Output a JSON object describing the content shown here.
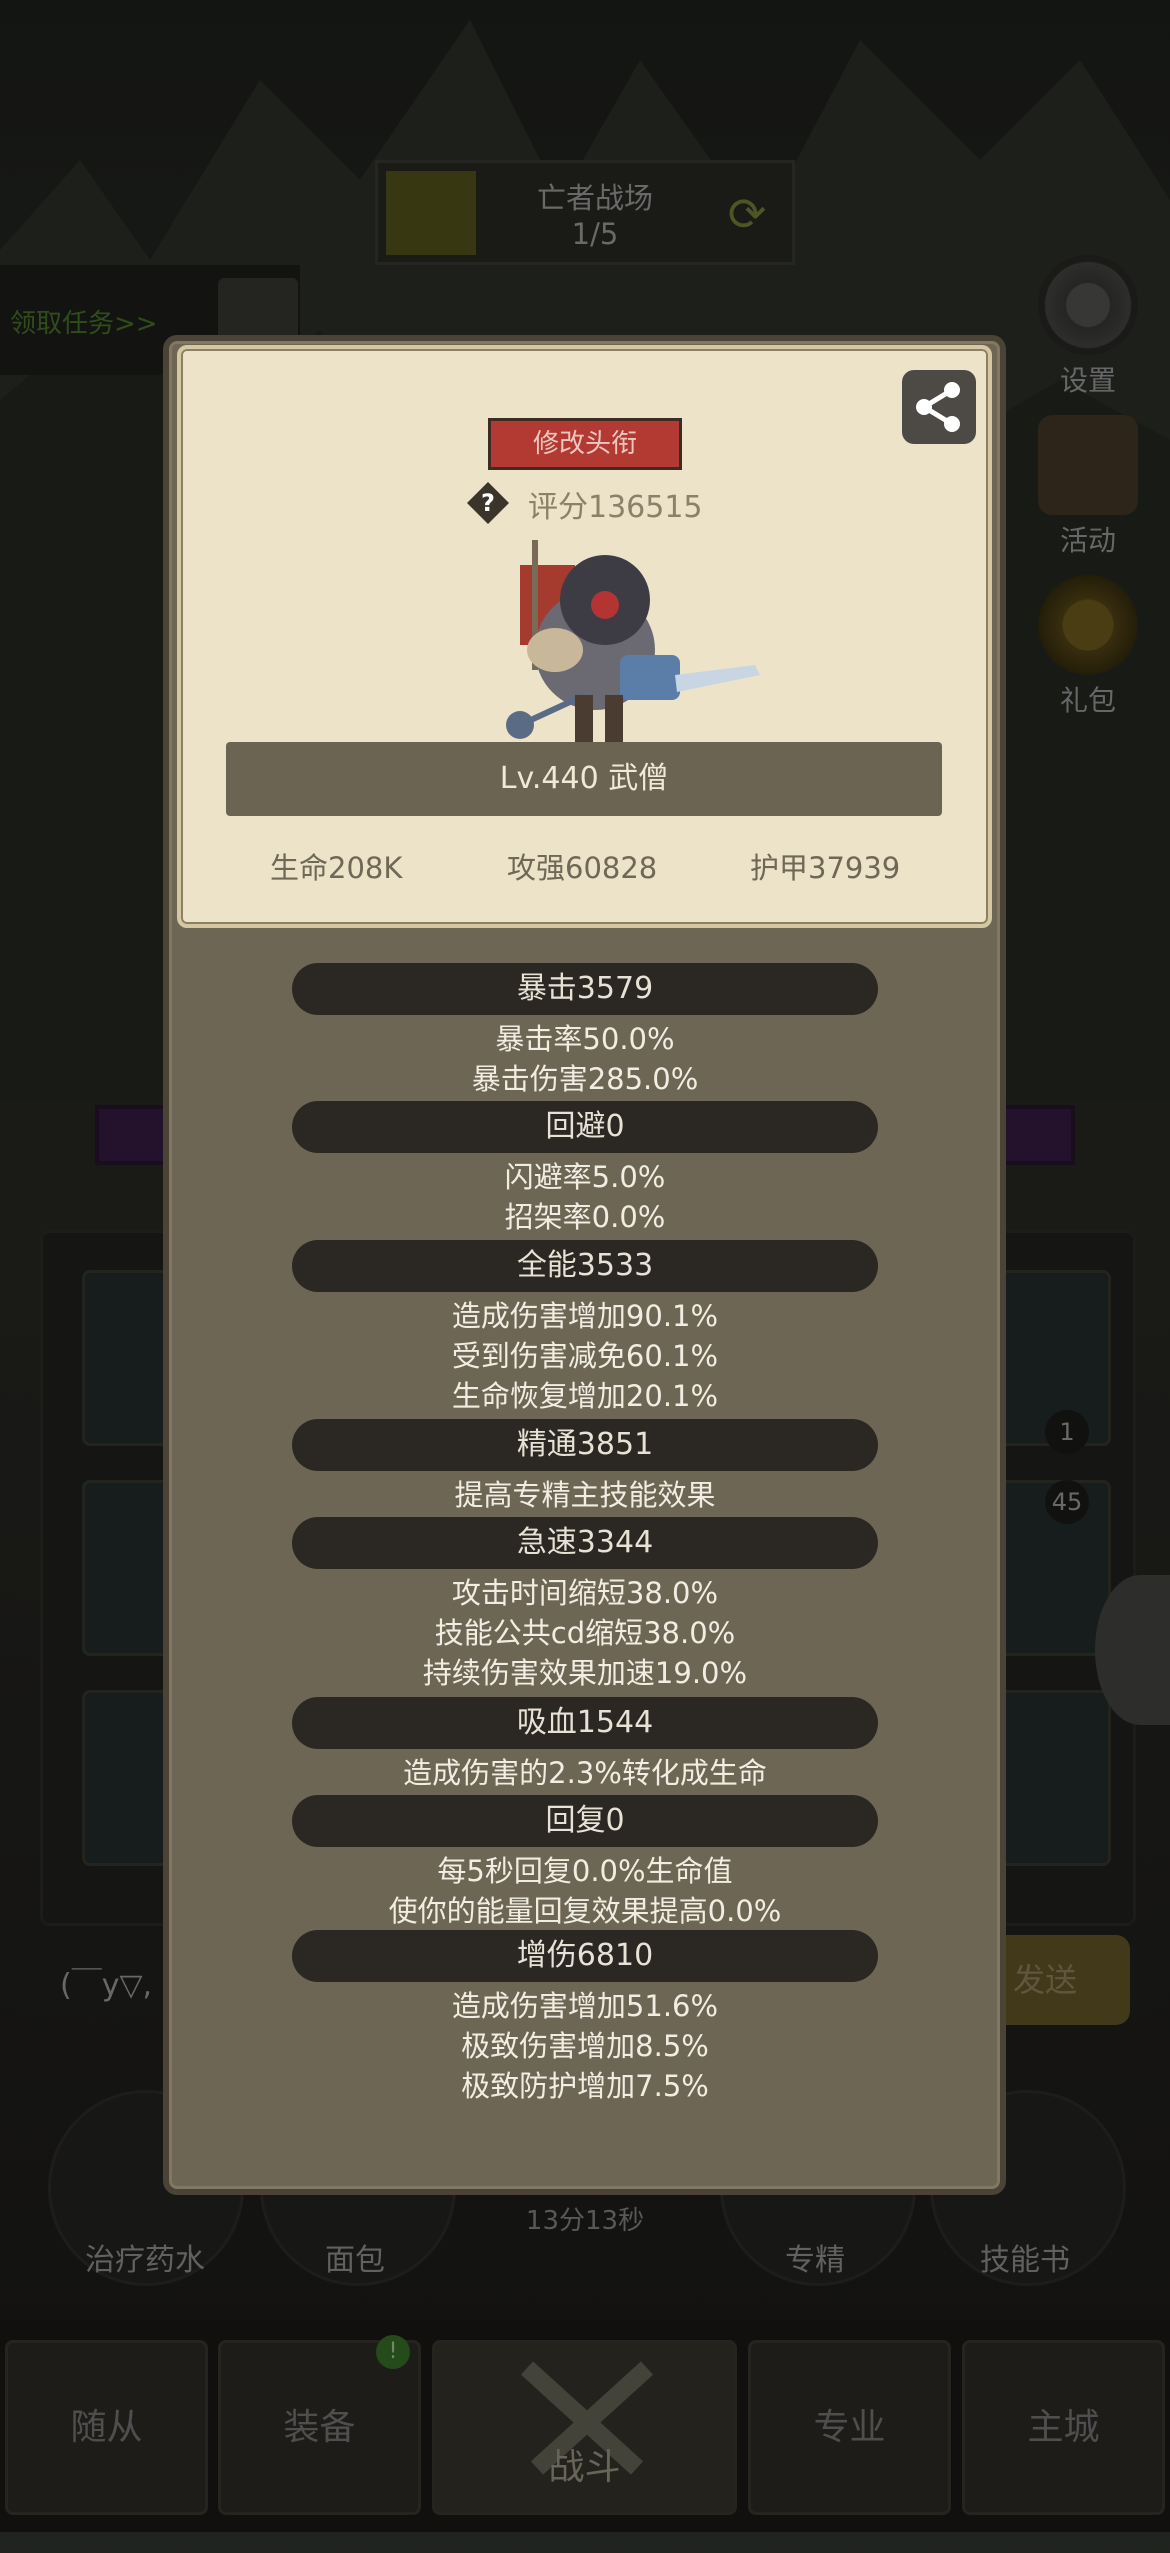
{
  "battlefield": {
    "name": "亡者战场",
    "progress": "1/5"
  },
  "quest": {
    "label": "领取任务>>"
  },
  "side_menu": [
    {
      "label": "设置",
      "icon": "gear-icon"
    },
    {
      "label": "活动",
      "icon": "scroll-icon"
    },
    {
      "label": "礼包",
      "icon": "gift-icon"
    }
  ],
  "chat": {
    "text": "(￣y▽,",
    "send_label": "发送"
  },
  "slot_badges": [
    "1",
    "45"
  ],
  "actions": [
    {
      "label": "治疗药水"
    },
    {
      "label": "面包"
    },
    {
      "label": "专精"
    },
    {
      "label": "技能书"
    }
  ],
  "timer": "13分13秒",
  "tabs": [
    {
      "label": "随从"
    },
    {
      "label": "装备"
    },
    {
      "label": "战斗"
    },
    {
      "label": "专业"
    },
    {
      "label": "主城"
    }
  ],
  "dialog": {
    "title_button": "修改头衔",
    "score": "评分136515",
    "level_name": "Lv.440 武僧",
    "basic_stats": [
      "生命208K",
      "攻强60828",
      "护甲37939"
    ],
    "stats": [
      {
        "header": "暴击3579",
        "lines": [
          "暴击率50.0%",
          "暴击伤害285.0%"
        ]
      },
      {
        "header": "回避0",
        "lines": [
          "闪避率5.0%",
          "招架率0.0%"
        ]
      },
      {
        "header": "全能3533",
        "lines": [
          "造成伤害增加90.1%",
          "受到伤害减免60.1%",
          "生命恢复增加20.1%"
        ]
      },
      {
        "header": "精通3851",
        "lines": [
          "提高专精主技能效果"
        ]
      },
      {
        "header": "急速3344",
        "lines": [
          "攻击时间缩短38.0%",
          "技能公共cd缩短38.0%",
          "持续伤害效果加速19.0%"
        ]
      },
      {
        "header": "吸血1544",
        "lines": [
          "造成伤害的2.3%转化成生命"
        ]
      },
      {
        "header": "回复0",
        "lines": [
          "每5秒回复0.0%生命值",
          "使你的能量回复效果提高0.0%"
        ]
      },
      {
        "header": "增伤6810",
        "lines": [
          "造成伤害增加51.6%",
          "极致伤害增加8.5%",
          "极致防护增加7.5%"
        ]
      }
    ]
  }
}
